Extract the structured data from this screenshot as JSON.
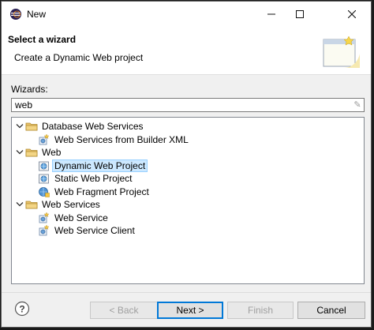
{
  "window": {
    "title": "New"
  },
  "titlebar": {
    "minimize": "—",
    "maximize": "☐",
    "close": "✕"
  },
  "header": {
    "title": "Select a wizard",
    "description": "Create a Dynamic Web project"
  },
  "wizards": {
    "label": "Wizards:",
    "filter_value": "web",
    "clear_glyph": "✎"
  },
  "tree": [
    {
      "label": "Database Web Services",
      "level": 0,
      "expanded": true,
      "icon": "folder-icon"
    },
    {
      "label": "Web Services from Builder XML",
      "level": 1,
      "icon": "web-service-wizard-icon"
    },
    {
      "label": "Web",
      "level": 0,
      "expanded": true,
      "icon": "folder-icon"
    },
    {
      "label": "Dynamic Web Project",
      "level": 1,
      "icon": "web-project-icon",
      "selected": true
    },
    {
      "label": "Static Web Project",
      "level": 1,
      "icon": "web-project-icon"
    },
    {
      "label": "Web Fragment Project",
      "level": 1,
      "icon": "web-fragment-icon"
    },
    {
      "label": "Web Services",
      "level": 0,
      "expanded": true,
      "icon": "folder-icon"
    },
    {
      "label": "Web Service",
      "level": 1,
      "icon": "web-service-wizard-icon"
    },
    {
      "label": "Web Service Client",
      "level": 1,
      "icon": "web-service-wizard-icon"
    }
  ],
  "buttons": {
    "back": "< Back",
    "next": "Next >",
    "finish": "Finish",
    "cancel": "Cancel"
  },
  "colors": {
    "selection_bg": "#cce8ff",
    "default_button_border": "#0078d7",
    "folder": "#e8c16a"
  }
}
